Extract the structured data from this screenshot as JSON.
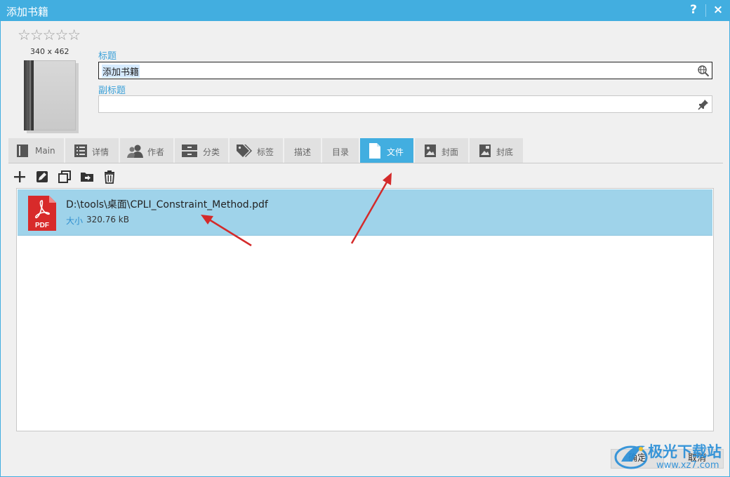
{
  "window": {
    "title": "添加书籍",
    "help": "?",
    "close": "×"
  },
  "cover": {
    "rating_stars": "☆☆☆☆☆",
    "dimensions": "340 x 462"
  },
  "fields": {
    "title_label": "标题",
    "title_value": "添加书籍",
    "subtitle_label": "副标题",
    "subtitle_value": ""
  },
  "tabs": [
    {
      "label": "Main",
      "icon": "bookmark-icon"
    },
    {
      "label": "详情",
      "icon": "list-icon"
    },
    {
      "label": "作者",
      "icon": "people-icon"
    },
    {
      "label": "分类",
      "icon": "drawer-icon"
    },
    {
      "label": "标签",
      "icon": "tag-icon"
    },
    {
      "label": "描述",
      "icon": ""
    },
    {
      "label": "目录",
      "icon": ""
    },
    {
      "label": "文件",
      "icon": "file-icon",
      "active": true
    },
    {
      "label": "封面",
      "icon": "image-icon"
    },
    {
      "label": "封底",
      "icon": "image-back-icon"
    }
  ],
  "toolbar": [
    "add-icon",
    "edit-icon",
    "copy-icon",
    "move-folder-icon",
    "delete-icon"
  ],
  "file": {
    "path": "D:\\tools\\桌面\\CPLI_Constraint_Method.pdf",
    "size_label": "大小",
    "size": "320.76 kB",
    "badge": "PDF"
  },
  "buttons": {
    "ok": "确定",
    "cancel": "取消"
  },
  "watermark": {
    "main": "极光下载站",
    "sub": "www.xz7.com"
  },
  "colors": {
    "accent": "#42aee0",
    "selection": "#9fd3ea",
    "arrow": "#d42a2a",
    "pdf": "#d82a2a"
  }
}
